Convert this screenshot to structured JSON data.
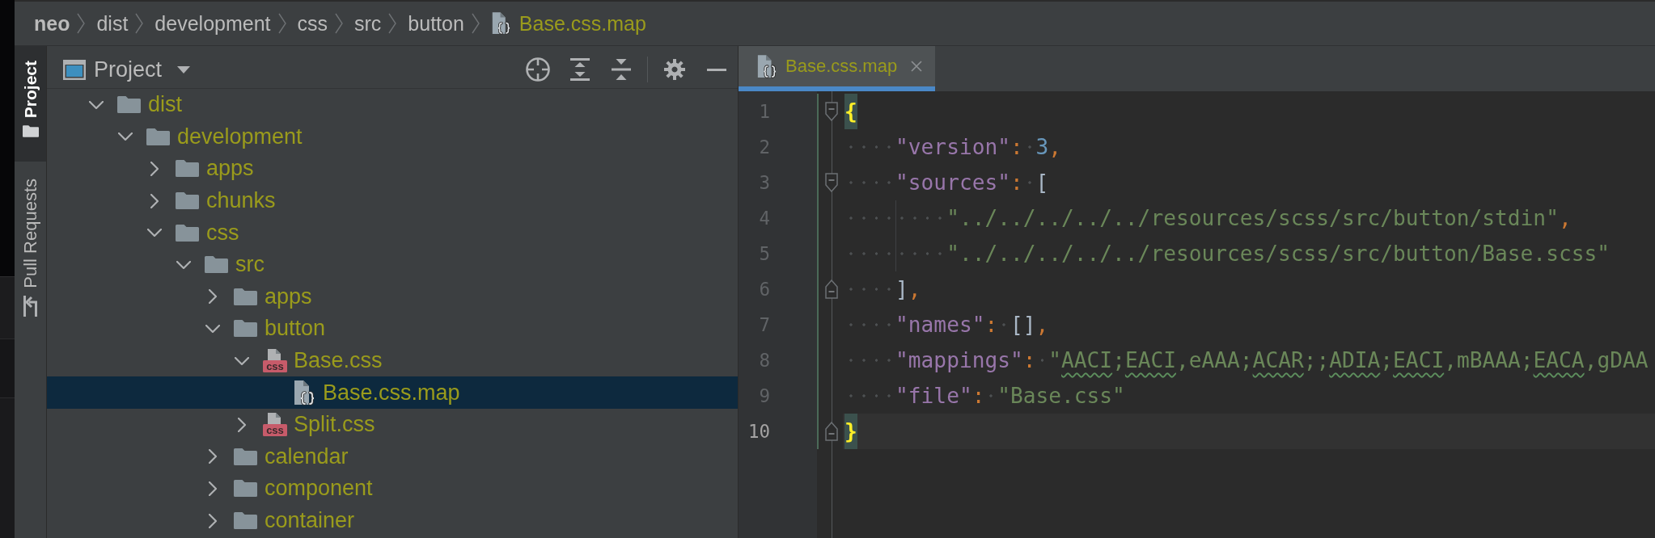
{
  "breadcrumbs": [
    {
      "label": "neo",
      "kind": "project"
    },
    {
      "label": "dist",
      "kind": "folder"
    },
    {
      "label": "development",
      "kind": "folder"
    },
    {
      "label": "css",
      "kind": "folder"
    },
    {
      "label": "src",
      "kind": "folder"
    },
    {
      "label": "button",
      "kind": "folder"
    },
    {
      "label": "Base.css.map",
      "kind": "map"
    }
  ],
  "tool_window_bar": {
    "tabs": [
      {
        "label": "Project",
        "kind": "project",
        "selected": true
      },
      {
        "label": "Pull Requests",
        "kind": "pull_requests",
        "selected": false
      }
    ]
  },
  "project_panel": {
    "title": "Project",
    "tree": [
      {
        "label": "dist",
        "kind": "folder",
        "expanded": true,
        "selected": false,
        "children": [
          {
            "label": "development",
            "kind": "folder",
            "expanded": true,
            "selected": false,
            "children": [
              {
                "label": "apps",
                "kind": "folder",
                "expanded": false,
                "selected": false
              },
              {
                "label": "chunks",
                "kind": "folder",
                "expanded": false,
                "selected": false
              },
              {
                "label": "css",
                "kind": "folder",
                "expanded": true,
                "selected": false,
                "children": [
                  {
                    "label": "src",
                    "kind": "folder",
                    "expanded": true,
                    "selected": false,
                    "children": [
                      {
                        "label": "apps",
                        "kind": "folder",
                        "expanded": false,
                        "selected": false
                      },
                      {
                        "label": "button",
                        "kind": "folder",
                        "expanded": true,
                        "selected": false,
                        "children": [
                          {
                            "label": "Base.css",
                            "kind": "css",
                            "icon_text": "css",
                            "expanded": true,
                            "selected": false,
                            "children": [
                              {
                                "label": "Base.css.map",
                                "kind": "map",
                                "selected": true
                              }
                            ]
                          },
                          {
                            "label": "Split.css",
                            "kind": "css",
                            "icon_text": "css",
                            "expanded": false,
                            "selected": false
                          }
                        ]
                      },
                      {
                        "label": "calendar",
                        "kind": "folder",
                        "expanded": false,
                        "selected": false
                      },
                      {
                        "label": "component",
                        "kind": "folder",
                        "expanded": false,
                        "selected": false
                      },
                      {
                        "label": "container",
                        "kind": "folder",
                        "expanded": false,
                        "selected": false
                      }
                    ]
                  }
                ]
              }
            ]
          }
        ]
      }
    ]
  },
  "editor": {
    "tabs": [
      {
        "label": "Base.css.map",
        "kind": "map",
        "selected": true
      }
    ],
    "lines": [
      {
        "number": "1",
        "current": false,
        "fold": {
          "kind": "start"
        },
        "tokens": [
          {
            "kind": "brace",
            "text": "{",
            "matched": true
          }
        ]
      },
      {
        "number": "2",
        "current": false,
        "tokens": [
          {
            "kind": "key",
            "text": "    \"version\""
          },
          {
            "kind": "punct",
            "text": ": "
          },
          {
            "kind": "number",
            "text": "3"
          },
          {
            "kind": "punct",
            "text": ","
          }
        ]
      },
      {
        "number": "3",
        "current": false,
        "fold": {
          "kind": "start"
        },
        "tokens": [
          {
            "kind": "key",
            "text": "    \"sources\""
          },
          {
            "kind": "punct",
            "text": ": "
          },
          {
            "kind": "bracket",
            "text": "["
          }
        ]
      },
      {
        "number": "4",
        "current": false,
        "tokens": [
          {
            "kind": "string",
            "text": "        \"../../../../../resources/scss/src/button/stdin\""
          },
          {
            "kind": "punct",
            "text": ","
          }
        ]
      },
      {
        "number": "5",
        "current": false,
        "tokens": [
          {
            "kind": "string",
            "text": "        \"../../../../../resources/scss/src/button/Base.scss\""
          }
        ]
      },
      {
        "number": "6",
        "current": false,
        "fold": {
          "kind": "end"
        },
        "tokens": [
          {
            "kind": "bracket",
            "text": "    ]"
          },
          {
            "kind": "punct",
            "text": ","
          }
        ]
      },
      {
        "number": "7",
        "current": false,
        "tokens": [
          {
            "kind": "key",
            "text": "    \"names\""
          },
          {
            "kind": "punct",
            "text": ": "
          },
          {
            "kind": "bracket",
            "text": "[]"
          },
          {
            "kind": "punct",
            "text": ","
          }
        ]
      },
      {
        "number": "8",
        "current": false,
        "tokens": [
          {
            "kind": "key",
            "text": "    \"mappings\""
          },
          {
            "kind": "punct",
            "text": ": "
          },
          {
            "kind": "string",
            "segments": [
              {
                "text": "\"",
                "typo": false
              },
              {
                "text": "AACI",
                "typo": true
              },
              {
                "text": ";",
                "typo": false
              },
              {
                "text": "EACI",
                "typo": true
              },
              {
                "text": ",eAAA;",
                "typo": false
              },
              {
                "text": "ACAR",
                "typo": true
              },
              {
                "text": ";;",
                "typo": false
              },
              {
                "text": "ADIA",
                "typo": true
              },
              {
                "text": ";",
                "typo": false
              },
              {
                "text": "EACI",
                "typo": true
              },
              {
                "text": ",mBAAA;",
                "typo": false
              },
              {
                "text": "EACA",
                "typo": true
              },
              {
                "text": ",gDAA",
                "typo": false
              }
            ]
          }
        ]
      },
      {
        "number": "9",
        "current": false,
        "tokens": [
          {
            "kind": "key",
            "text": "    \"file\""
          },
          {
            "kind": "punct",
            "text": ": "
          },
          {
            "kind": "string",
            "text": "\"Base.css\""
          }
        ]
      },
      {
        "number": "10",
        "current": true,
        "fold": {
          "kind": "end"
        },
        "tokens": [
          {
            "kind": "brace",
            "text": "}",
            "matched": true
          }
        ]
      }
    ]
  }
}
